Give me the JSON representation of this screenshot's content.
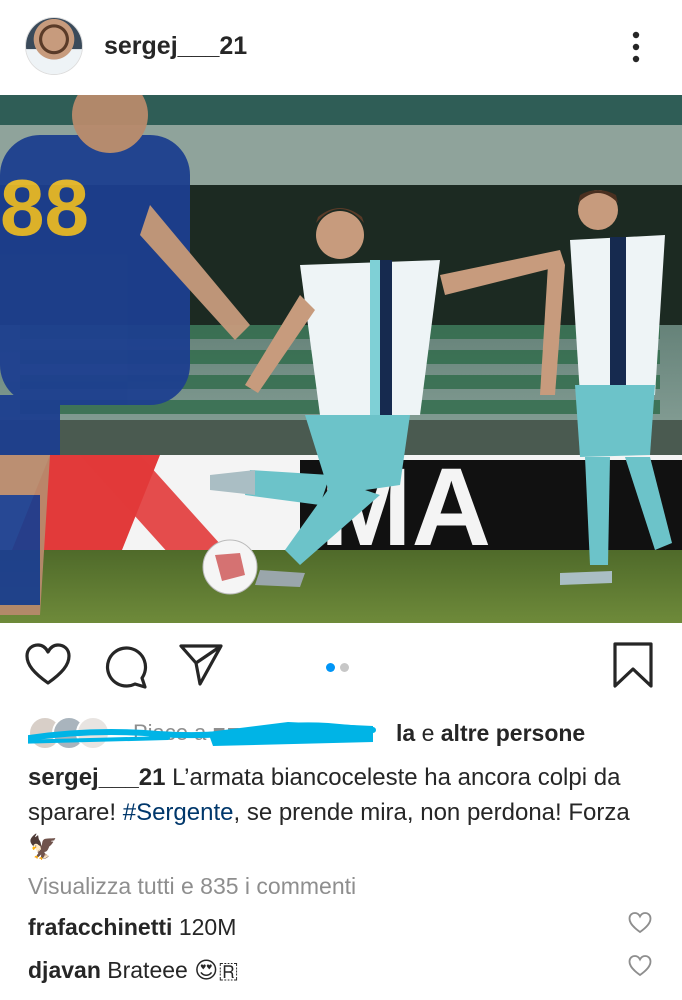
{
  "header": {
    "username": "sergej___21"
  },
  "likes": {
    "prefix": "Piace a",
    "suffix": "la",
    "joiner": "e",
    "others": "altre persone"
  },
  "caption": {
    "username": "sergej___21",
    "text1": "L’armata biancoceleste ha ancora colpi da sparare!",
    "hashtag": "#Sergente",
    "text2": ", se prende mira, non perdona! Forza",
    "emoji": "🦅"
  },
  "view_all_comments": "Visualizza tutti e 835 i commenti",
  "comments": [
    {
      "username": "frafacchinetti",
      "text": "120M"
    },
    {
      "username": "djavan",
      "text": "Brateee",
      "emoji": "😍",
      "glyph": "🇷"
    }
  ],
  "colors": {
    "text": "#262626",
    "muted": "#8e8e8e",
    "hashtag": "#00376b",
    "carousel_active": "#0095f6",
    "carousel_inactive": "#c7c7c7",
    "scribble": "#00b4e6"
  },
  "icons": {
    "more": "vertical-ellipsis",
    "like": "heart-outline",
    "comment": "speech-bubble",
    "share": "paper-plane",
    "save": "bookmark-outline"
  },
  "carousel": {
    "current": 1,
    "total": 2
  }
}
